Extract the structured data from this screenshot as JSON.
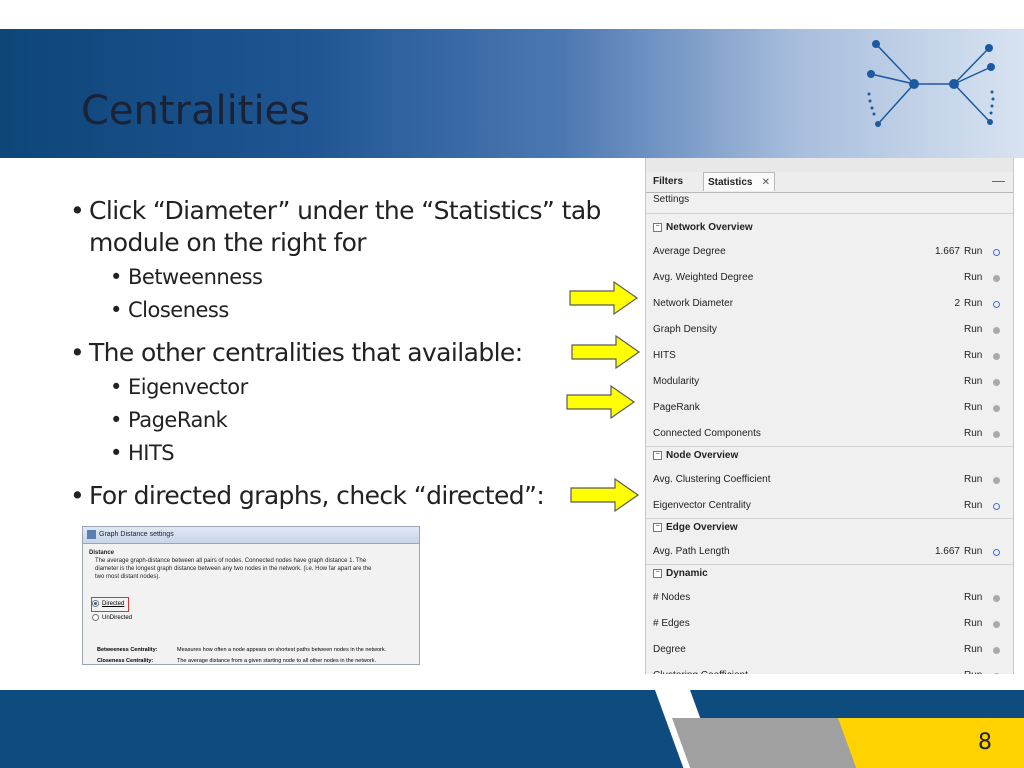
{
  "title": "Centralities",
  "bullets": [
    {
      "text": "Click “Diameter” under the “Statistics” tab",
      "cont": "module on the right for"
    },
    {
      "text": "Betweenness"
    },
    {
      "text": "Closeness"
    },
    {
      "text": "The other centralities that available:"
    },
    {
      "text": "Eigenvector"
    },
    {
      "text": "PageRank"
    },
    {
      "text": "HITS"
    },
    {
      "text": "For directed graphs, check “directed”:"
    }
  ],
  "bullet_glyph": "•",
  "dialog": {
    "title": "Graph Distance settings",
    "section": "Distance",
    "desc1": "The average graph-distance between all pairs of nodes. Connected nodes have graph distance 1. The",
    "desc2": "diameter is the longest graph distance between any two nodes in the network. (i.e. How far apart are the",
    "desc3": "two most distant nodes).",
    "opt_directed": "Directed",
    "opt_undirected": "UnDirected",
    "def1_label": "Betweeness Centrality:",
    "def1_text": "Measures how often a node appears on shortest paths between nodes in the network.",
    "def2_label": "Closeness Centrality:",
    "def2_text": "The average distance from a given starting node to all other nodes in the network."
  },
  "panel": {
    "tab_filters": "Filters",
    "tab_statistics": "Statistics",
    "tab_close": "✕",
    "minimize": "—",
    "settings": "Settings",
    "run_label": "Run",
    "groups": [
      {
        "name": "Network Overview",
        "rows": [
          {
            "label": "Average Degree",
            "value": "1.667",
            "status": "help"
          },
          {
            "label": "Avg. Weighted Degree",
            "value": "",
            "status": "dot"
          },
          {
            "label": "Network Diameter",
            "value": "2",
            "status": "help"
          },
          {
            "label": "Graph Density",
            "value": "",
            "status": "dot"
          },
          {
            "label": "HITS",
            "value": "",
            "status": "dot"
          },
          {
            "label": "Modularity",
            "value": "",
            "status": "dot"
          },
          {
            "label": "PageRank",
            "value": "",
            "status": "dot"
          },
          {
            "label": "Connected Components",
            "value": "",
            "status": "dot"
          }
        ]
      },
      {
        "name": "Node Overview",
        "rows": [
          {
            "label": "Avg. Clustering Coefficient",
            "value": "",
            "status": "dot"
          },
          {
            "label": "Eigenvector Centrality",
            "value": "",
            "status": "help"
          }
        ]
      },
      {
        "name": "Edge Overview",
        "rows": [
          {
            "label": "Avg. Path Length",
            "value": "1.667",
            "status": "help"
          }
        ]
      },
      {
        "name": "Dynamic",
        "rows": [
          {
            "label": "# Nodes",
            "value": "",
            "status": "dot"
          },
          {
            "label": "# Edges",
            "value": "",
            "status": "dot"
          },
          {
            "label": "Degree",
            "value": "",
            "status": "dot"
          },
          {
            "label": "Clustering Coefficient",
            "value": "",
            "status": "dot"
          }
        ]
      }
    ]
  },
  "colors": {
    "arrow_fill": "#ffff00",
    "arrow_stroke": "#5a5a5a",
    "header_dark": "#0d4679",
    "footer_blue": "#0e4b7f",
    "footer_yellow": "#ffd200"
  },
  "page_number": "8"
}
